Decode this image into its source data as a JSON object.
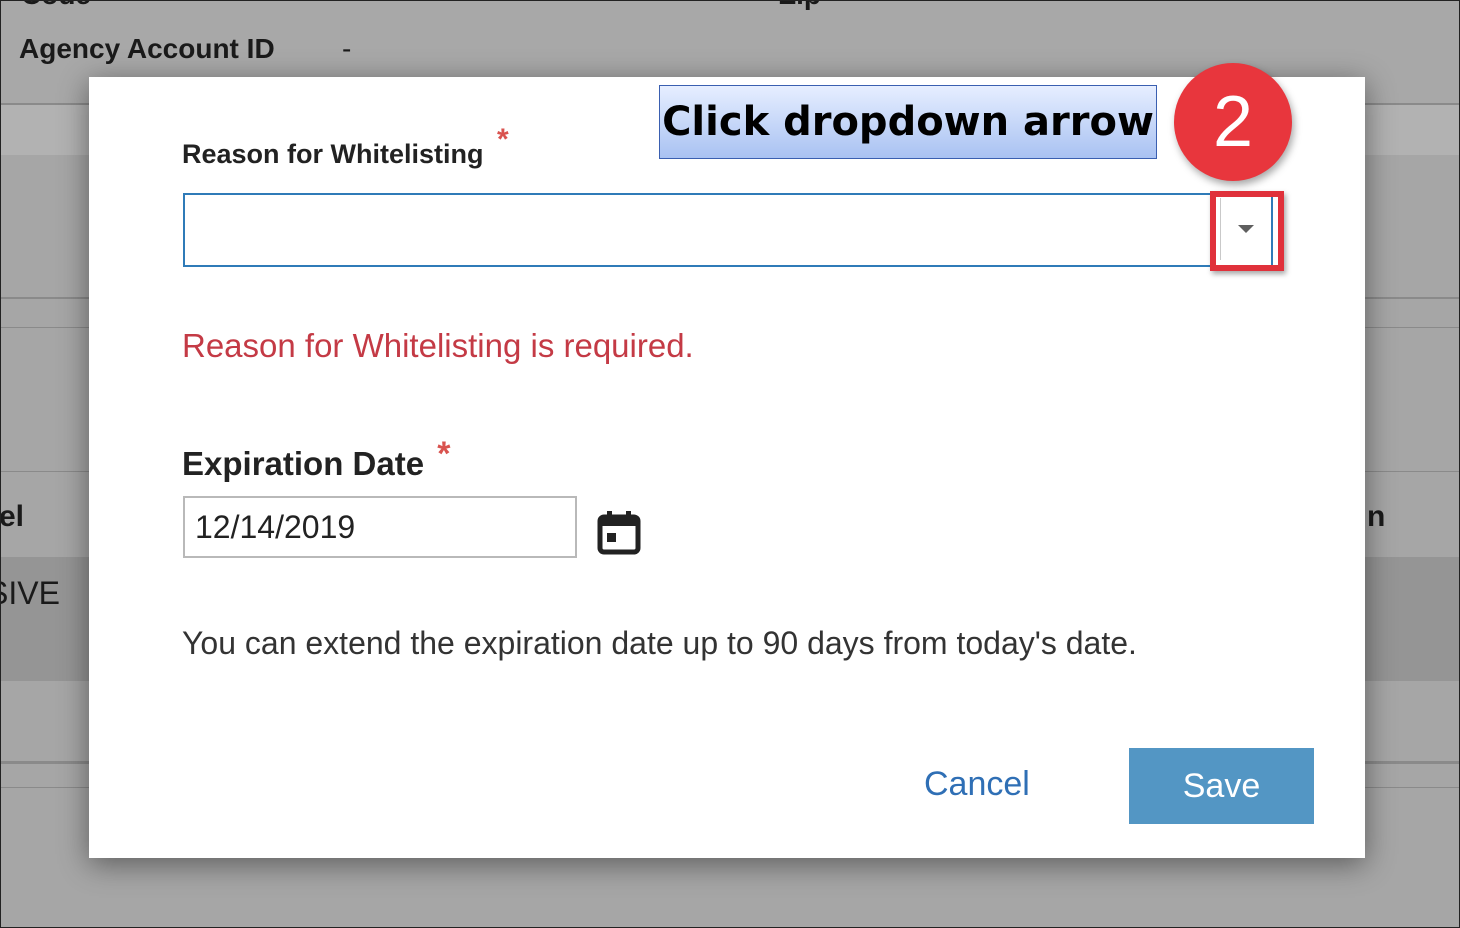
{
  "background": {
    "partial_top_left": "Code",
    "partial_top_mid": "Zip",
    "agency_label": "Agency Account ID",
    "agency_value": "-",
    "left_edge_label": "el",
    "left_edge_status": "SIVE",
    "right_edge_label": "n"
  },
  "modal": {
    "reason_label": "Reason for Whitelisting",
    "required_mark": "*",
    "reason_value": "",
    "error_text": "Reason for Whitelisting is required.",
    "expiration_label": "Expiration Date",
    "expiration_value": "12/14/2019",
    "help_text": "You can extend the expiration date up to 90 days from today's date.",
    "cancel_label": "Cancel",
    "save_label": "Save"
  },
  "annotation": {
    "callout_text": "Click dropdown arrow",
    "step_number": "2"
  },
  "icons": {
    "dropdown": "chevron-down-icon",
    "calendar": "calendar-icon"
  },
  "colors": {
    "error": "#c43a45",
    "required": "#d9534f",
    "primary_button": "#5396c4",
    "link": "#2f6fb5",
    "highlight": "#e0313b",
    "badge": "#e8363d"
  }
}
